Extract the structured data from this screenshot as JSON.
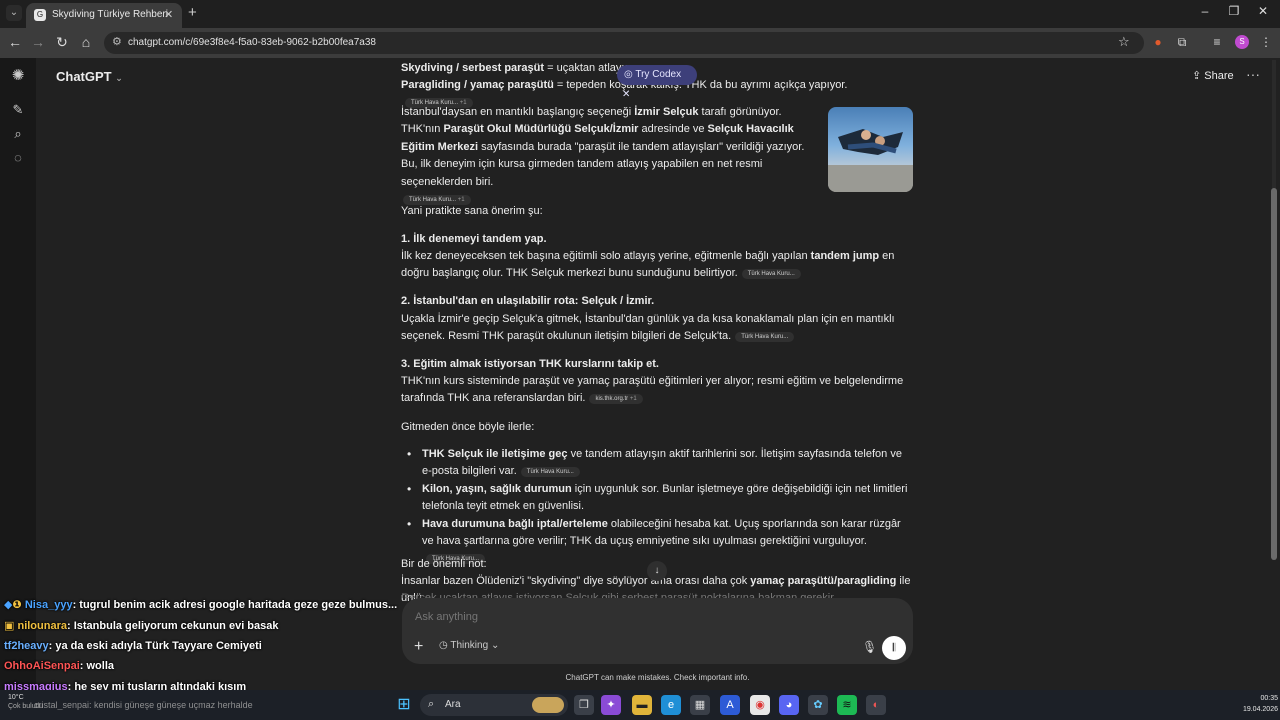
{
  "browser": {
    "tab_title": "Skydiving Türkiye Rehberi",
    "tab_favicon": "G",
    "url": "chatgpt.com/c/69e3f8e4-f5a0-83eb-9062-b2b00fea7a38",
    "profile_initial": "S"
  },
  "app": {
    "title": "ChatGPT",
    "share_label": "Share",
    "try_codex_label": "Try Codex"
  },
  "content": {
    "top1_bold": "Skydiving / serbest paraşüt",
    "top1_text": " = uçaktan atlayış.",
    "top2_bold": "Paragliding / yamaç paraşütü",
    "top2_text": " = tepeden koşarak kalkış. THK da bu ayrımı açıkça yapıyor.",
    "p1": {
      "t1": "İstanbul'daysan en mantıklı başlangıç seçeneği ",
      "b1": "İzmir Selçuk",
      "t2": " tarafı görünüyor. THK'nın ",
      "b2": "Paraşüt Okul Müdürlüğü Selçuk/İzmir",
      "t3": " adresinde ve ",
      "b3": "Selçuk Havacılık Eğitim Merkezi",
      "t4": " sayfasında burada \"paraşüt ile tandem atlayışları\" verildiği yazıyor. Bu, ilk deneyim için kursa girmeden tandem atlayış yapabilen en net resmi seçeneklerden biri."
    },
    "intro": "Yani pratikte sana önerim şu:",
    "s1_title": "1. İlk denemeyi tandem yap.",
    "s1": {
      "t1": "İlk kez deneyeceksen tek başına eğitimli solo atlayış yerine, eğitmenle bağlı yapılan ",
      "b1": "tandem jump",
      "t2": " en doğru başlangıç olur. THK Selçuk merkezi bunu sunduğunu belirtiyor."
    },
    "s2_title": "2. İstanbul'dan en ulaşılabilir rota: Selçuk / İzmir.",
    "s2": "Uçakla İzmir'e geçip Selçuk'a gitmek, İstanbul'dan günlük ya da kısa konaklamalı plan için en mantıklı seçenek. Resmi THK paraşüt okulunun iletişim bilgileri de Selçuk'ta.",
    "s3_title": "3. Eğitim almak istiyorsan THK kurslarını takip et.",
    "s3": "THK'nın kurs sisteminde paraşüt ve yamaç paraşütü eğitimleri yer alıyor; resmi eğitim ve belgelendirme tarafında THK ana referanslardan biri.",
    "before": "Gitmeden önce böyle ilerle:",
    "bullets": {
      "b1_bold": "THK Selçuk ile iletişime geç",
      "b1_text": " ve tandem atlayışın aktif tarihlerini sor. İletişim sayfasında telefon ve e-posta bilgileri var.",
      "b2_bold": "Kilon, yaşın, sağlık durumun",
      "b2_text": " için uygunluk sor. Bunlar işletmeye göre değişebildiği için net limitleri telefonla teyit etmek en güvenlisi.",
      "b3_bold": "Hava durumuna bağlı iptal/erteleme",
      "b3_text": " olabileceğini hesaba kat. Uçuş sporlarında son karar rüzgâr ve hava şartlarına göre verilir; THK da uçuş emniyetine sıkı uyulması gerektiğini vurguluyor."
    },
    "note_title": "Bir de önemli not:",
    "note": {
      "t1": "İnsanlar bazen Ölüdeniz'i \"skydiving\" diye söylüyor ama orası daha çok ",
      "b1": "yamaç paraşütü/paragliding",
      "t2": " ile ünlü."
    },
    "note_cut": "Gerçek uçaktan atlayış istiyorsan Selçuk gibi serbest paraşüt noktalarına bakman gerekir."
  },
  "citations": {
    "thk": "Türk Hava Kuru...",
    "plus1": "+1",
    "kis": "kis.thk.org.tr"
  },
  "composer": {
    "placeholder": "Ask anything",
    "thinking_label": "Thinking"
  },
  "disclaimer": "ChatGPT can make mistakes. Check important info.",
  "overlay_chat": [
    {
      "user": "Nisa_yyy",
      "msg": ": tugrul benim acik adresi google haritada geze geze bulmus..."
    },
    {
      "user": "nilounara",
      "msg": ": Istanbula geliyorum cekunun evi basak"
    },
    {
      "user": "tf2heavy",
      "msg": ": ya da eski adıyla Türk Tayyare Cemiyeti"
    },
    {
      "user": "OhhoAiSenpai",
      "msg": ": wolla"
    },
    {
      "user": "missmagius",
      "msg": ": he şey mi tuşların altındaki kısım"
    },
    {
      "user": "cristal_senpai",
      "msg": ": kendisi güneşe güneşe uçmaz herhalde"
    }
  ],
  "taskbar": {
    "search_label": "Ara",
    "weather_temp": "10°C",
    "weather_desc": "Çok bulutlu",
    "time": "00:35",
    "date": "19.04.2026"
  },
  "colors": {
    "background": "#212121",
    "codex_badge": "#3d3f7a",
    "user1": "#4aa3ff",
    "user2": "#f0c040",
    "user3": "#6ab0ff",
    "user4": "#ff5555",
    "user5": "#c97cff"
  }
}
